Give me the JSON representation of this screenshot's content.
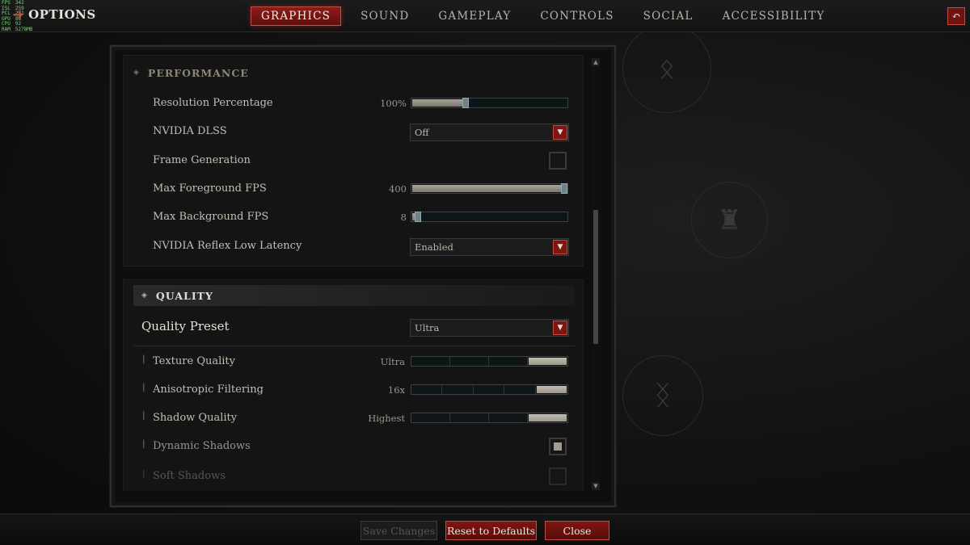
{
  "fps_overlay": [
    {
      "label": "FPS",
      "value": "342"
    },
    {
      "label": "ISL",
      "value": "259"
    },
    {
      "label": "PCL",
      "value": "271"
    },
    {
      "label": "GPU",
      "value": "88"
    },
    {
      "label": "CPU",
      "value": "92"
    },
    {
      "label": "RAM",
      "value": "5278MB"
    }
  ],
  "header": {
    "title": "OPTIONS",
    "tabs": [
      {
        "label": "GRAPHICS",
        "active": true
      },
      {
        "label": "SOUND",
        "active": false
      },
      {
        "label": "GAMEPLAY",
        "active": false
      },
      {
        "label": "CONTROLS",
        "active": false
      },
      {
        "label": "SOCIAL",
        "active": false
      },
      {
        "label": "ACCESSIBILITY",
        "active": false
      }
    ],
    "exit_icon": "return-icon"
  },
  "performance": {
    "header": "PERFORMANCE",
    "resolution_percentage": {
      "label": "Resolution Percentage",
      "value": "100%",
      "level": 0.34
    },
    "nvidia_dlss": {
      "label": "NVIDIA DLSS",
      "value": "Off"
    },
    "frame_generation": {
      "label": "Frame Generation",
      "checked": false
    },
    "max_foreground_fps": {
      "label": "Max Foreground FPS",
      "value": "400",
      "level": 1.0
    },
    "max_background_fps": {
      "label": "Max Background FPS",
      "value": "8",
      "level": 0.02
    },
    "nvidia_reflex": {
      "label": "NVIDIA Reflex Low Latency",
      "value": "Enabled"
    }
  },
  "quality": {
    "header": "QUALITY",
    "preset": {
      "label": "Quality Preset",
      "value": "Ultra"
    },
    "texture_quality": {
      "label": "Texture Quality",
      "value": "Ultra",
      "steps": 4,
      "selected": 4
    },
    "anisotropic_filtering": {
      "label": "Anisotropic Filtering",
      "value": "16x",
      "steps": 5,
      "selected": 5
    },
    "shadow_quality": {
      "label": "Shadow Quality",
      "value": "Highest",
      "steps": 4,
      "selected": 4
    },
    "dynamic_shadows": {
      "label": "Dynamic Shadows",
      "checked": true
    },
    "soft_shadows": {
      "label": "Soft Shadows",
      "checked": false
    }
  },
  "footer": {
    "save_changes": "Save Changes",
    "reset_defaults": "Reset to Defaults",
    "close": "Close"
  },
  "colors": {
    "accent_red": "#7e1612",
    "accent_border": "#c14d42",
    "background": "#111111"
  }
}
